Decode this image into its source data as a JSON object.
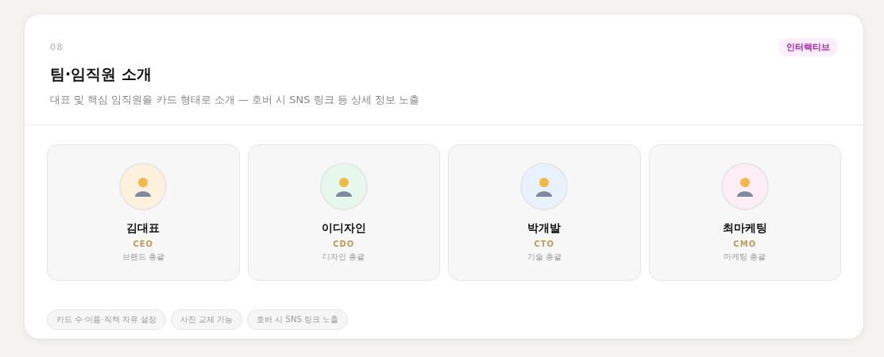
{
  "section": {
    "number": "08",
    "badge": "인터랙티브",
    "title": "팀·임직원 소개",
    "description": "대표 및 핵심 임직원을 카드 형태로 소개 — 호버 시 SNS 링크 등 상세 정보 노출"
  },
  "members": [
    {
      "name": "김대표",
      "role": "CEO",
      "duty": "브랜드 총괄",
      "color": "#fdf0dc"
    },
    {
      "name": "이디자인",
      "role": "CDO",
      "duty": "디자인 총괄",
      "color": "#e6f8ee"
    },
    {
      "name": "박개발",
      "role": "CTO",
      "duty": "기술 총괄",
      "color": "#e8f1fc"
    },
    {
      "name": "최마케팅",
      "role": "CMO",
      "duty": "마케팅 총괄",
      "color": "#fceef4"
    }
  ],
  "features": [
    "카드 수·이름·직책 자유 설정",
    "사진 교체 가능",
    "호버 시 SNS 링크 노출"
  ]
}
